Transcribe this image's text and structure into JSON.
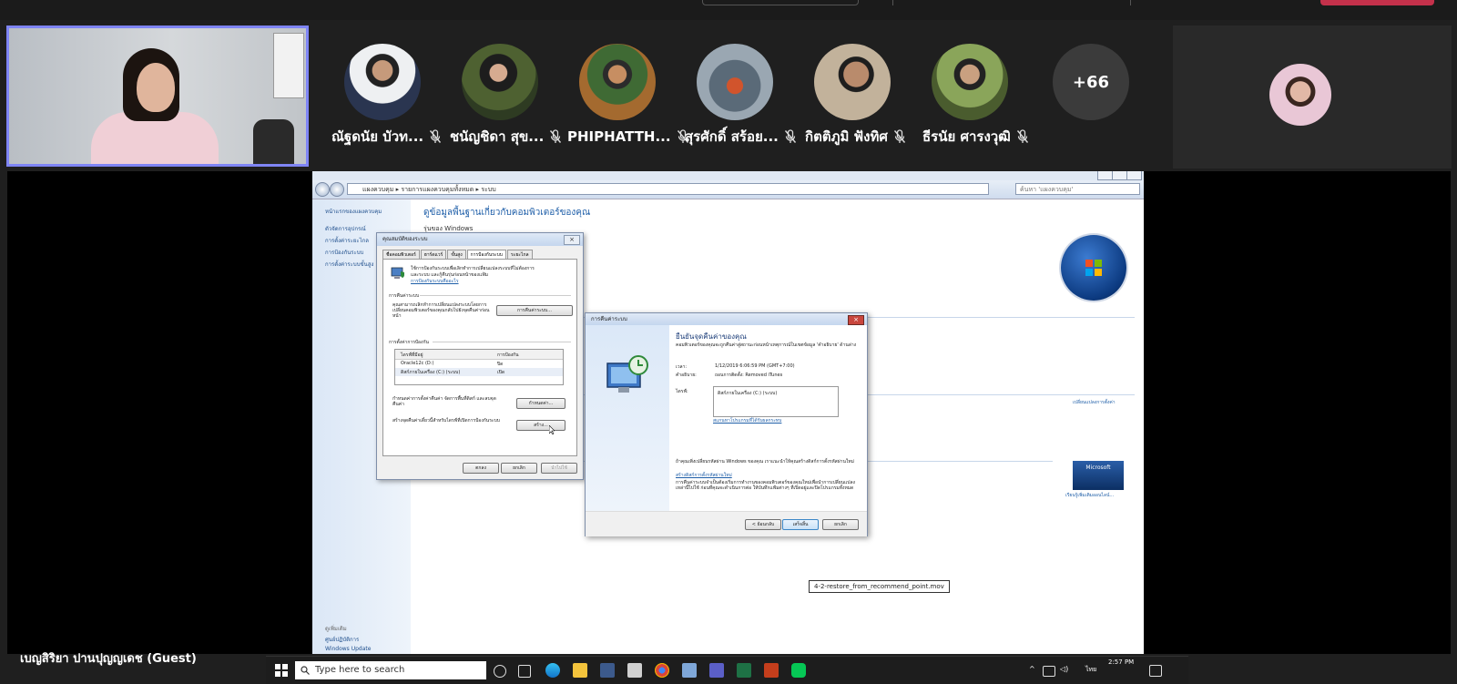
{
  "meeting": {
    "participants": [
      {
        "name": "ณัฐดนัย บัวท...",
        "avatar_color": "#e9e2d3"
      },
      {
        "name": "ชนัญชิดา สุข...",
        "avatar_color": "#5c6b3a"
      },
      {
        "name": "PHIPHATTH...",
        "avatar_color": "#8a5a2b"
      },
      {
        "name": "สุรศักดิ์ สร้อย...",
        "avatar_color": "#6f7f8c"
      },
      {
        "name": "กิตติภูมิ ฟังทิศ",
        "avatar_color": "#a08e78"
      },
      {
        "name": "ธีรนัย ศารงวุฒิ",
        "avatar_color": "#7e9a52"
      }
    ],
    "more_count": "+66",
    "guest_label": "เบญสิริยา ปานปุญญเดช (Guest)",
    "accent": "#7f85f5"
  },
  "screen": {
    "address": "แผงควบคุม  ▸  รายการแผงควบคุมทั้งหมด  ▸  ระบบ",
    "search_placeholder": "ค้นหา 'แผงควบคุม'",
    "left_pane": {
      "home": "หน้าแรกของแผงควบคุม",
      "links": [
        "ตัวจัดการอุปกรณ์",
        "การตั้งค่าระยะไกล",
        "การป้องกันระบบ",
        "การตั้งค่าระบบขั้นสูง"
      ],
      "see_also": "ดูเพิ่มเติม",
      "bottom_links": [
        "ศูนย์ปฏิบัติการ",
        "Windows Update"
      ]
    },
    "main_title": "ดูข้อมูลพื้นฐานเกี่ยวกับคอมพิวเตอร์ของคุณ",
    "main_sub": "รุ่นของ Windows",
    "change_settings": "เปลี่ยนแปลงการตั้งค่า",
    "ms_badge": "Microsoft",
    "ms_link": "เรียนรู้เพิ่มเติมออนไลน์...",
    "tooltip": "4-2-restore_from_recommend_point.mov"
  },
  "sysprops": {
    "title": "คุณสมบัติของระบบ",
    "tabs": [
      "ชื่อคอมพิวเตอร์",
      "ฮาร์ดแวร์",
      "ขั้นสูง",
      "การป้องกันระบบ",
      "ระยะไกล"
    ],
    "intro": "ใช้การป้องกันระบบเพื่อเลิกทำการเปลี่ยนแปลงระบบที่ไม่ต้องการ",
    "intro2": "และระบบ และกู้คืนรุ่นก่อนหน้าของแฟ้ม",
    "intro_link": "การป้องกันระบบคืออะไร",
    "restore_section": "การคืนค่าระบบ",
    "restore_text": "คุณสามารถเลิกทำการเปลี่ยนแปลงระบบโดยการเปลี่ยนคอมพิวเตอร์ของคุณกลับไปยังจุดคืนค่าก่อนหน้า",
    "restore_btn": "การคืนค่าระบบ...",
    "protect_section": "การตั้งค่าการป้องกัน",
    "col_drive": "ไดรฟ์ที่มีอยู่",
    "col_protect": "การป้องกัน",
    "drives": [
      {
        "name": "Oracle12c (D:)",
        "state": "ปิด"
      },
      {
        "name": "ดิสก์ภายในเครื่อง (C:) (ระบบ)",
        "state": "เปิด"
      }
    ],
    "config_text": "กำหนดค่าการตั้งค่าคืนค่า จัดการพื้นที่ดิสก์ และลบจุดคืนค่า",
    "config_btn": "กำหนดค่า...",
    "create_text": "สร้างจุดคืนค่าเดี๋ยวนี้สำหรับไดรฟ์ที่เปิดการป้องกันระบบ",
    "create_btn": "สร้าง...",
    "ok": "ตกลง",
    "cancel": "ยกเลิก",
    "apply": "นำไปใช้"
  },
  "restore": {
    "title": "การคืนค่าระบบ",
    "heading": "ยืนยันจุดคืนค่าของคุณ",
    "desc": "คอมพิวเตอร์ของคุณจะถูกคืนค่าสู่สถานะก่อนหน้าเหตุการณ์ในเขตข้อมูล 'คำอธิบาย' ด้านล่าง",
    "time_label": "เวลา:",
    "time_value": "1/12/2019 6:06:59 PM (GMT+7:00)",
    "desc_label": "คำอธิบาย:",
    "desc_value": "ถอนการติดตั้ง: Removed iTunes",
    "drives_label": "ไดรฟ์:",
    "drives_value": "ดิสก์ภายในเครื่อง (C:) (ระบบ)",
    "scan_link": "สแกนหาโปรแกรมที่ได้รับผลกระทบ",
    "pw_text": "ถ้าคุณเพิ่งเปลี่ยนรหัสผ่าน Windows ของคุณ เราแนะนำให้คุณสร้างดิสก์การตั้งรหัสผ่านใหม่",
    "pw_link": "สร้างดิสก์การตั้งรหัสผ่านใหม่",
    "warn_text": "การคืนค่าระบบจำเป็นต้องเริ่มการทำงานของคอมพิวเตอร์ของคุณใหม่เพื่อนำการเปลี่ยนแปลงเหล่านี้ไปใช้ ก่อนที่คุณจะดำเนินการต่อ ให้บันทึกแฟ้มต่างๆ ที่เปิดอยู่และปิดโปรแกรมทั้งหมด",
    "back_btn": "< ย้อนกลับ",
    "finish_btn": "เสร็จสิ้น",
    "cancel_btn": "ยกเลิก"
  },
  "taskbar": {
    "search_placeholder": "Type here to search",
    "time": "2:57 PM",
    "lang": "ไทย"
  }
}
